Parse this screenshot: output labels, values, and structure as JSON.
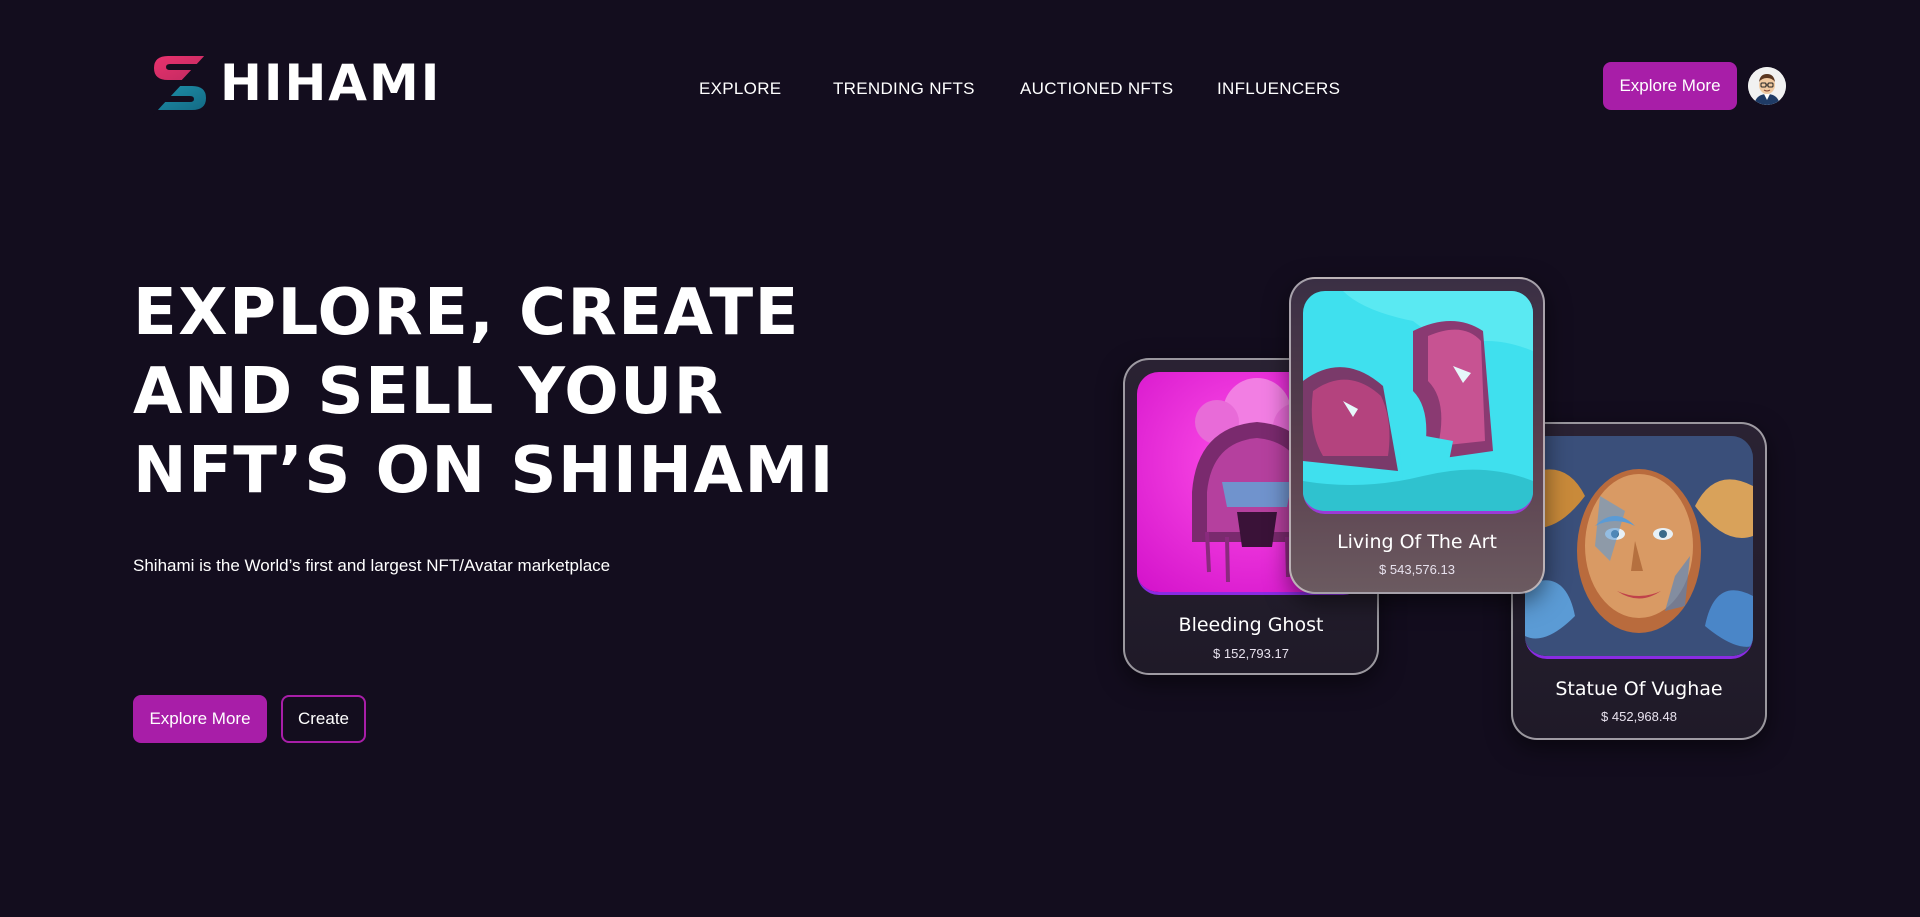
{
  "brand": {
    "name": "HIHAMI",
    "accent": "#a81ea8",
    "background": "#130d1e"
  },
  "nav": {
    "items": [
      {
        "label": "EXPLORE"
      },
      {
        "label": "TRENDING NFTS"
      },
      {
        "label": "AUCTIONED NFTS"
      },
      {
        "label": "INFLUENCERS"
      }
    ],
    "cta_label": "Explore More",
    "avatar_icon": "user-avatar-icon"
  },
  "hero": {
    "title": "EXPLORE, CREATE AND SELL YOUR NFT’S ON SHIHAMI",
    "subtitle": "Shihami is the World’s first and largest NFT/Avatar marketplace",
    "primary_button": "Explore More",
    "secondary_button": "Create"
  },
  "cards": [
    {
      "name": "Bleeding Ghost",
      "price": "$ 152,793.17"
    },
    {
      "name": "Living Of The Art",
      "price": "$ 543,576.13"
    },
    {
      "name": "Statue Of Vughae",
      "price": "$ 452,968.48"
    }
  ]
}
